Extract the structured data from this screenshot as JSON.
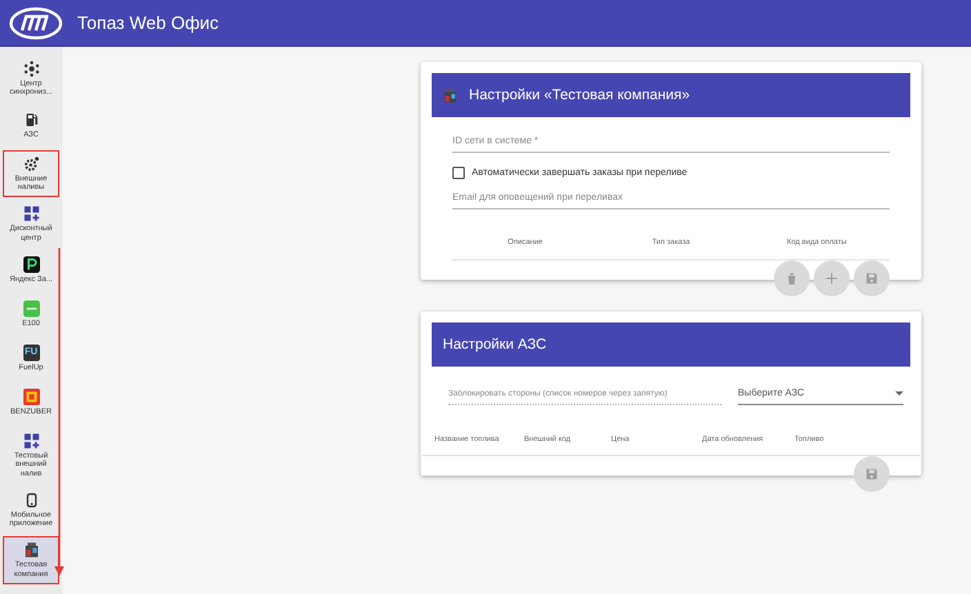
{
  "header": {
    "title": "Топаз Web Офис"
  },
  "sidebar": {
    "items": [
      {
        "label": "Центр синхрониз...",
        "kind": "sync",
        "selected": false,
        "highlighted": false
      },
      {
        "label": "АЗС",
        "kind": "pump",
        "selected": false,
        "highlighted": false
      },
      {
        "label": "Внешние наливы",
        "kind": "gear",
        "selected": false,
        "highlighted": true
      },
      {
        "label": "Дисконтный центр",
        "kind": "grid",
        "selected": false,
        "highlighted": false
      },
      {
        "label": "Яндекс За...",
        "kind": "yandex",
        "selected": false,
        "highlighted": false
      },
      {
        "label": "E100",
        "kind": "e100",
        "selected": false,
        "highlighted": false
      },
      {
        "label": "FuelUp",
        "kind": "fuelup",
        "badge": "FU",
        "selected": false,
        "highlighted": false
      },
      {
        "label": "BENZUBER",
        "kind": "benzuber",
        "selected": false,
        "highlighted": false
      },
      {
        "label": "Тестовый внешний налив",
        "kind": "grid",
        "selected": false,
        "highlighted": false
      },
      {
        "label": "Мобильное приложение",
        "kind": "mobile",
        "selected": false,
        "highlighted": false
      },
      {
        "label": "Тестовая компания",
        "kind": "company",
        "selected": true,
        "highlighted": true
      }
    ]
  },
  "company_card": {
    "title": "Настройки «Тестовая компания»",
    "network_id": {
      "placeholder": "ID сети в системе *"
    },
    "auto_complete": {
      "label": "Автоматически завершать заказы при переливе",
      "checked": false
    },
    "email": {
      "placeholder": "Email для оповещений при переливах"
    },
    "table": {
      "columns": [
        "Описание",
        "Тип заказа",
        "Код вида оплаты"
      ]
    },
    "actions": [
      {
        "kind": "delete"
      },
      {
        "kind": "add"
      },
      {
        "kind": "save"
      }
    ]
  },
  "station_card": {
    "title": "Настройки АЗС",
    "block_sides": {
      "placeholder": "Заблокировать стороны (список номеров через запятую)"
    },
    "station_select": {
      "placeholder": "Выберите АЗС"
    },
    "table": {
      "columns": [
        "Название топлива",
        "Внешний код",
        "Цена",
        "Дата обновления",
        "Топливо"
      ]
    },
    "actions": [
      {
        "kind": "save"
      }
    ]
  }
}
